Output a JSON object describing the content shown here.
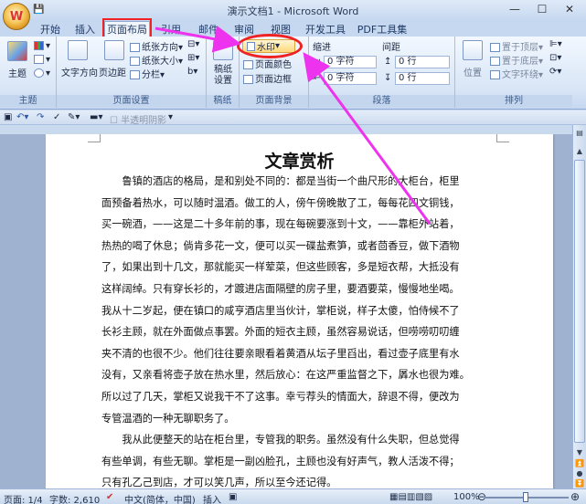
{
  "window": {
    "title": "演示文档1 - Microsoft Word",
    "controls": [
      "—",
      "☐",
      "✕"
    ]
  },
  "tabs": [
    "开始",
    "插入",
    "页面布局",
    "引用",
    "邮件",
    "审阅",
    "视图",
    "开发工具",
    "PDF工具集"
  ],
  "active_tab": "页面布局",
  "ribbon": {
    "theme": {
      "label": "主题",
      "group": "主题"
    },
    "page_setup": {
      "group": "页面设置",
      "text_direction": "文字方向",
      "margins": "页边距",
      "orientation": "纸张方向",
      "size": "纸张大小",
      "columns": "分栏"
    },
    "draft": {
      "label": "稿纸设置",
      "group": "稿纸"
    },
    "page_background": {
      "group": "页面背景",
      "watermark": "水印",
      "page_color": "页面颜色",
      "page_border": "页面边框"
    },
    "paragraph": {
      "group": "段落",
      "indent": "缩进",
      "spacing": "间距",
      "indent_left": "0 字符",
      "indent_right": "0 字符",
      "spacing_before": "0 行",
      "spacing_after": "0 行"
    },
    "arrange": {
      "group": "排列",
      "position": "位置",
      "bring_front": "置于顶层",
      "send_back": "置于底层",
      "text_wrap": "文字环绕"
    }
  },
  "qat": {
    "checkbox_label": "半透明阴影"
  },
  "document": {
    "title": "文章赏析",
    "lines": [
      "　　鲁镇的酒店的格局，是和别处不同的：都是当街一个曲尺形的大柜台，柜里",
      "面预备着热水，可以随时温酒。做工的人，傍午傍晚散了工，每每花四文铜钱，",
      "买一碗酒，——这是二十多年前的事，现在每碗要涨到十文，——靠柜外站着，",
      "热热的喝了休息；倘肯多花一文，便可以买一碟盐煮笋，或者茴香豆，做下酒物",
      "了，如果出到十几文，那就能买一样荤菜，但这些顾客，多是短衣帮，大抵没有",
      "这样阔绰。只有穿长衫的，才踱进店面隔壁的房子里，要酒要菜，慢慢地坐喝。",
      "我从十二岁起，便在镇口的咸亨酒店里当伙计，掌柜说，样子太傻，怕侍候不了",
      "长衫主顾，就在外面做点事罢。外面的短衣主顾，虽然容易说话，但唠唠叨叨缠",
      "夹不清的也很不少。他们往往要亲眼看着黄酒从坛子里舀出，看过壶子底里有水",
      "没有，又亲看将壶子放在热水里，然后放心：在这严重监督之下，羼水也很为难。",
      "所以过了几天，掌柜又说我干不了这事。幸亏荐头的情面大，辞退不得，便改为",
      "专管温酒的一种无聊职务了。",
      "　　我从此便整天的站在柜台里，专管我的职务。虽然没有什么失职，但总觉得",
      "有些单调，有些无聊。掌柜是一副凶脸孔，主顾也没有好声气，教人活泼不得；",
      "只有孔乙己到店，才可以笑几声，所以至今还记得。"
    ]
  },
  "status": {
    "page": "页面: 1/4",
    "words": "字数: 2,610",
    "language": "中文(简体，中国)",
    "mode": "插入",
    "zoom": "100%"
  },
  "colors": {
    "highlight_red": "#ee2222",
    "arrow_magenta": "#ee33ee"
  }
}
